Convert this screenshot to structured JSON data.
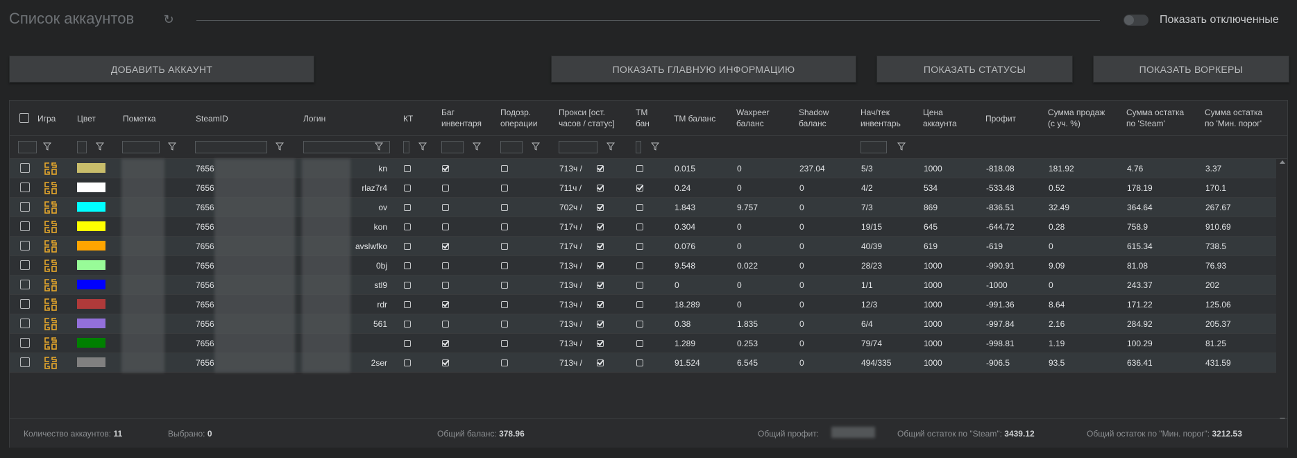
{
  "header": {
    "title": "Список аккаунтов",
    "show_disabled_label": "Показать отключенные"
  },
  "buttons": {
    "add": "ДОБАВИТЬ АККАУНТ",
    "main_info": "ПОКАЗАТЬ ГЛАВНУЮ ИНФОРМАЦИЮ",
    "statuses": "ПОКАЗАТЬ СТАТУСЫ",
    "workers": "ПОКАЗАТЬ ВОРКЕРЫ"
  },
  "columns": {
    "game": "Игра",
    "color": "Цвет",
    "note": "Пометка",
    "steamid": "SteamID",
    "login": "Логин",
    "kt": "КТ",
    "bug_inv_1": "Баг",
    "bug_inv_2": "инвентаря",
    "susp_1": "Подозр.",
    "susp_2": "операции",
    "proxy_1": "Прокси [ост.",
    "proxy_2": "часов / статус]",
    "tmban_1": "ТМ",
    "tmban_2": "бан",
    "tm_balance": "ТМ баланс",
    "wax_1": "Waxpeer",
    "wax_2": "баланс",
    "shadow_1": "Shadow",
    "shadow_2": "баланс",
    "inv_1": "Нач/тек",
    "inv_2": "инвентарь",
    "price_1": "Цена",
    "price_2": "аккаунта",
    "profit": "Профит",
    "sales_1": "Сумма продаж",
    "sales_2": "(с уч. %)",
    "steam_rest_1": "Сумма остатка",
    "steam_rest_2": "по 'Steam'",
    "min_rest_1": "Сумма остатка",
    "min_rest_2": "по 'Мин. порог'"
  },
  "colors": {
    "accent_game": "#e8a92b",
    "background": "#232425"
  },
  "rows": [
    {
      "color": "#c8bd6b",
      "steamid": "7656",
      "login": "kn",
      "kt": false,
      "bug": true,
      "susp": false,
      "proxy": "713ч /",
      "tmban": false,
      "tm": "0.015",
      "wax": "0",
      "shadow": "237.04",
      "inv": "5/3",
      "price": "1000",
      "profit": "-818.08",
      "sales": "181.92",
      "steam_rest": "4.76",
      "min_rest": "3.37"
    },
    {
      "color": "#ffffff",
      "steamid": "7656",
      "login": "rlaz7r4",
      "kt": false,
      "bug": false,
      "susp": false,
      "proxy": "711ч /",
      "tmban": true,
      "tm": "0.24",
      "wax": "0",
      "shadow": "0",
      "inv": "4/2",
      "price": "534",
      "profit": "-533.48",
      "sales": "0.52",
      "steam_rest": "178.19",
      "min_rest": "170.1"
    },
    {
      "color": "#00ffff",
      "steamid": "7656",
      "login": "ov",
      "kt": false,
      "bug": false,
      "susp": false,
      "proxy": "702ч /",
      "tmban": false,
      "tm": "1.843",
      "wax": "9.757",
      "shadow": "0",
      "inv": "7/3",
      "price": "869",
      "profit": "-836.51",
      "sales": "32.49",
      "steam_rest": "364.64",
      "min_rest": "267.67"
    },
    {
      "color": "#ffff00",
      "steamid": "7656",
      "login": "kon",
      "kt": false,
      "bug": false,
      "susp": false,
      "proxy": "717ч /",
      "tmban": false,
      "tm": "0.304",
      "wax": "0",
      "shadow": "0",
      "inv": "19/15",
      "price": "645",
      "profit": "-644.72",
      "sales": "0.28",
      "steam_rest": "758.9",
      "min_rest": "910.69"
    },
    {
      "color": "#ffa500",
      "steamid": "7656",
      "login": "avslwfko",
      "kt": false,
      "bug": true,
      "susp": false,
      "proxy": "717ч /",
      "tmban": false,
      "tm": "0.076",
      "wax": "0",
      "shadow": "0",
      "inv": "40/39",
      "price": "619",
      "profit": "-619",
      "sales": "0",
      "steam_rest": "615.34",
      "min_rest": "738.5"
    },
    {
      "color": "#98fb98",
      "steamid": "7656",
      "login": "0bj",
      "kt": false,
      "bug": false,
      "susp": false,
      "proxy": "713ч /",
      "tmban": false,
      "tm": "9.548",
      "wax": "0.022",
      "shadow": "0",
      "inv": "28/23",
      "price": "1000",
      "profit": "-990.91",
      "sales": "9.09",
      "steam_rest": "81.08",
      "min_rest": "76.93"
    },
    {
      "color": "#0000ff",
      "steamid": "7656",
      "login": "stl9",
      "kt": false,
      "bug": false,
      "susp": false,
      "proxy": "713ч /",
      "tmban": false,
      "tm": "0",
      "wax": "0",
      "shadow": "0",
      "inv": "1/1",
      "price": "1000",
      "profit": "-1000",
      "sales": "0",
      "steam_rest": "243.37",
      "min_rest": "202"
    },
    {
      "color": "#b03a3a",
      "steamid": "7656",
      "login": "rdr",
      "kt": false,
      "bug": true,
      "susp": false,
      "proxy": "713ч /",
      "tmban": false,
      "tm": "18.289",
      "wax": "0",
      "shadow": "0",
      "inv": "12/3",
      "price": "1000",
      "profit": "-991.36",
      "sales": "8.64",
      "steam_rest": "171.22",
      "min_rest": "125.06"
    },
    {
      "color": "#9370db",
      "steamid": "7656",
      "login": "561",
      "kt": false,
      "bug": false,
      "susp": false,
      "proxy": "713ч /",
      "tmban": false,
      "tm": "0.38",
      "wax": "1.835",
      "shadow": "0",
      "inv": "6/4",
      "price": "1000",
      "profit": "-997.84",
      "sales": "2.16",
      "steam_rest": "284.92",
      "min_rest": "205.37"
    },
    {
      "color": "#008000",
      "steamid": "7656",
      "login": "",
      "kt": false,
      "bug": true,
      "susp": false,
      "proxy": "713ч /",
      "tmban": false,
      "tm": "1.289",
      "wax": "0.253",
      "shadow": "0",
      "inv": "79/74",
      "price": "1000",
      "profit": "-998.81",
      "sales": "1.19",
      "steam_rest": "100.29",
      "min_rest": "81.25"
    },
    {
      "color": "#808080",
      "steamid": "7656",
      "login": "2ser",
      "kt": false,
      "bug": true,
      "susp": false,
      "proxy": "713ч /",
      "tmban": false,
      "tm": "91.524",
      "wax": "6.545",
      "shadow": "0",
      "inv": "494/335",
      "price": "1000",
      "profit": "-906.5",
      "sales": "93.5",
      "steam_rest": "636.41",
      "min_rest": "431.59"
    }
  ],
  "footer": {
    "count_label": "Количество аккаунтов:",
    "count_value": "11",
    "selected_label": "Выбрано:",
    "selected_value": "0",
    "balance_label": "Общий баланс:",
    "balance_value": "378.96",
    "profit_label": "Общий профит:",
    "steam_rest_label": "Общий остаток по \"Steam\":",
    "steam_rest_value": "3439.12",
    "min_rest_label": "Общий остаток по \"Мин. порог\":",
    "min_rest_value": "3212.53"
  }
}
